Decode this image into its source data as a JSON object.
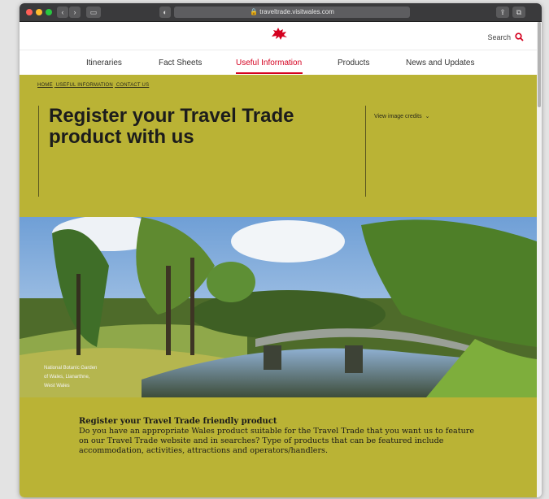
{
  "browser": {
    "url": "traveltrade.visitwales.com",
    "window_controls": [
      "close",
      "minimize",
      "zoom"
    ]
  },
  "header": {
    "search_label": "Search"
  },
  "nav": {
    "items": [
      {
        "label": "Itineraries"
      },
      {
        "label": "Fact Sheets"
      },
      {
        "label": "Useful Information"
      },
      {
        "label": "Products"
      },
      {
        "label": "News and Updates"
      }
    ],
    "active": "Useful Information"
  },
  "breadcrumb": [
    "HOME",
    "USEFUL INFORMATION",
    "CONTACT US"
  ],
  "hero": {
    "title": "Register your Travel Trade product with us",
    "credits_label": "View image credits"
  },
  "photo": {
    "caption": "National Botanic Garden of Wales, Llanarthne, West Wales"
  },
  "content": {
    "heading": "Register your Travel Trade friendly product",
    "paragraph": "Do you have an appropriate Wales product suitable for the Travel Trade that you want us to feature on our Travel Trade website and in searches? Type of products that can be featured include accommodation, activities, attractions and operators/handlers."
  },
  "colors": {
    "accent_red": "#d4001f",
    "band_olive": "#bab335"
  }
}
